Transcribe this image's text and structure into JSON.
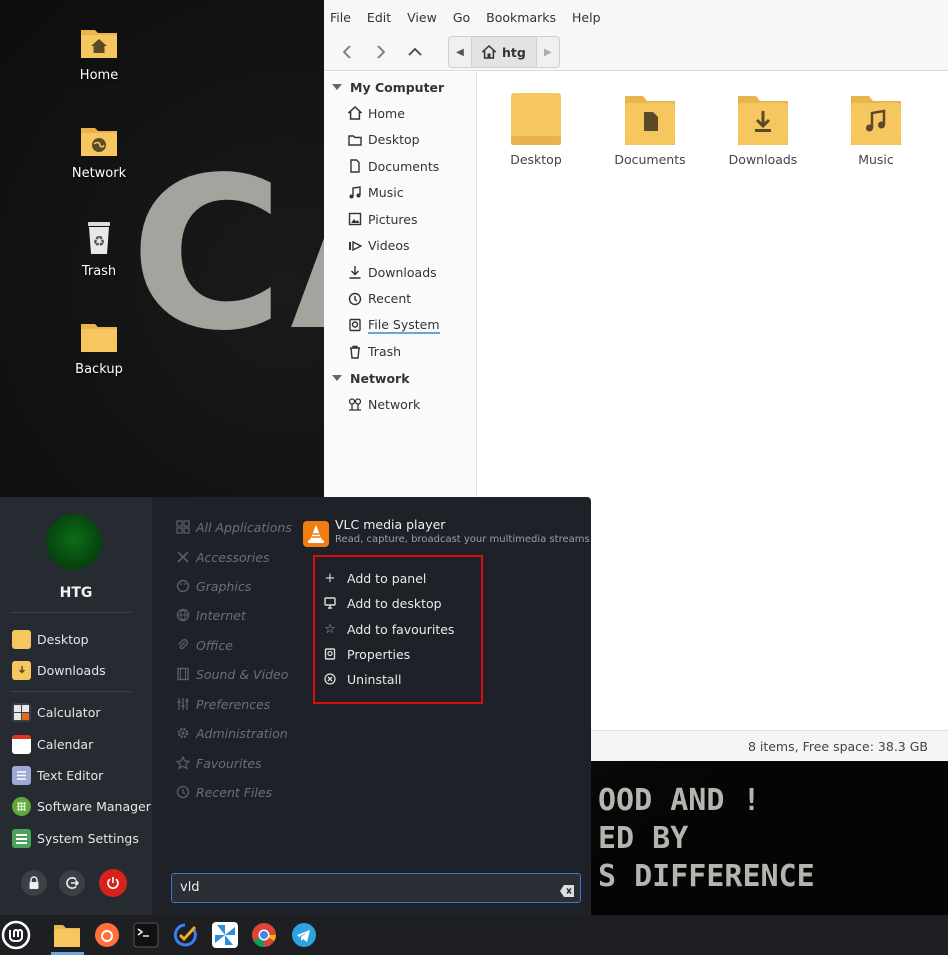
{
  "desktop": {
    "wallpaper_letters": "CA",
    "wallpaper_lines": [
      "OOD AND !",
      "ED BY",
      "S DIFFERENCE"
    ],
    "icons": [
      {
        "label": "Home"
      },
      {
        "label": "Network"
      },
      {
        "label": "Trash"
      },
      {
        "label": "Backup"
      }
    ]
  },
  "file_manager": {
    "menu": [
      "File",
      "Edit",
      "View",
      "Go",
      "Bookmarks",
      "Help"
    ],
    "path": "htg",
    "sidebar": {
      "my_computer": "My Computer",
      "items": [
        "Home",
        "Desktop",
        "Documents",
        "Music",
        "Pictures",
        "Videos",
        "Downloads",
        "Recent",
        "File System",
        "Trash"
      ],
      "network_head": "Network",
      "network_items": [
        "Network"
      ]
    },
    "folders": [
      "Desktop",
      "Documents",
      "Downloads",
      "Music"
    ],
    "status": "8 items, Free space: 38.3 GB"
  },
  "menu": {
    "user": "HTG",
    "places": [
      "Desktop",
      "Downloads"
    ],
    "apps": [
      "Calculator",
      "Calendar",
      "Text Editor",
      "Software Manager",
      "System Settings"
    ],
    "categories": [
      "All Applications",
      "Accessories",
      "Graphics",
      "Internet",
      "Office",
      "Sound & Video",
      "Preferences",
      "Administration",
      "Favourites",
      "Recent Files"
    ],
    "result": {
      "title": "VLC media player",
      "subtitle": "Read, capture, broadcast your multimedia streams"
    },
    "context": [
      "Add to panel",
      "Add to desktop",
      "Add to favourites",
      "Properties",
      "Uninstall"
    ],
    "search_value": "vld"
  },
  "colors": {
    "folder": "#f6c75e",
    "highlight_border": "#d81010",
    "power": "#d9211c"
  }
}
